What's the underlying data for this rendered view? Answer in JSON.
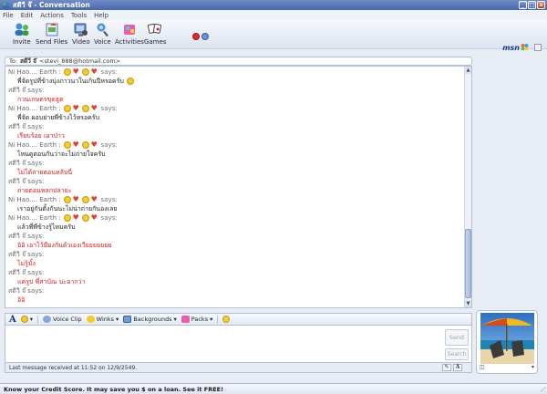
{
  "window": {
    "title": "สตีวี จ๊ - Conversation",
    "minimize": "_",
    "maximize": "□",
    "close": "x"
  },
  "menu": [
    "File",
    "Edit",
    "Actions",
    "Tools",
    "Help"
  ],
  "toolbar": {
    "items": [
      {
        "label": "Invite",
        "icon": "invite-icon"
      },
      {
        "label": "Send Files",
        "icon": "send-files-icon"
      },
      {
        "label": "Video",
        "icon": "video-icon"
      },
      {
        "label": "Voice",
        "icon": "voice-icon"
      },
      {
        "label": "Activities",
        "icon": "activities-icon"
      },
      {
        "label": "Games",
        "icon": "games-icon"
      }
    ],
    "brand": "msn"
  },
  "to_bar": {
    "prefix": "To:",
    "contact": "สตีวี จ๊",
    "email": "<stevi_888@hotmail.com>"
  },
  "chat": {
    "lines": [
      {
        "kind": "sender",
        "text": "Ni Hao.... Earth :",
        "emotes": [
          "smile",
          "heart",
          "smile",
          "heart"
        ],
        "suffix": "says:"
      },
      {
        "kind": "msg",
        "color": "black",
        "text": "พี่จัดรูปที่ข้างบุ่งภาวนาในเกินปีหรอครับ",
        "emotes": [
          "smile"
        ]
      },
      {
        "kind": "sender",
        "text": "สตีวี จ๊ says:"
      },
      {
        "kind": "msg",
        "color": "red",
        "text": "กวนเกษตรขุดธูต"
      },
      {
        "kind": "sender",
        "text": "Ni Hao.... Earth :",
        "emotes": [
          "smile",
          "heart",
          "smile",
          "heart"
        ],
        "suffix": "says:"
      },
      {
        "kind": "msg",
        "color": "black",
        "text": "พี่จัด ผอบย่ายพี่ข้างไว้หรอครับ"
      },
      {
        "kind": "sender",
        "text": "สตีวี จ๊ says:"
      },
      {
        "kind": "msg",
        "color": "red",
        "text": "เรียบร้อย เอาป่าว"
      },
      {
        "kind": "sender",
        "text": "Ni Hao.... Earth :",
        "emotes": [
          "smile",
          "heart",
          "smile",
          "heart"
        ],
        "suffix": "says:"
      },
      {
        "kind": "msg",
        "color": "black",
        "text": "ไหนดูตอนกันว่าจะไม่ถ่ายใจครับ"
      },
      {
        "kind": "sender",
        "text": "สตีวี จ๊ says:"
      },
      {
        "kind": "msg",
        "color": "red",
        "text": "ไม่ได้ถ่ายตอนหลับนี่"
      },
      {
        "kind": "sender",
        "text": "สตีวี จ๊ says:"
      },
      {
        "kind": "msg",
        "color": "red",
        "text": "ถ่ายตอนหลกปลาย่ะ"
      },
      {
        "kind": "sender",
        "text": "Ni Hao.... Earth :",
        "emotes": [
          "smile",
          "heart",
          "smile",
          "heart"
        ],
        "suffix": "says:"
      },
      {
        "kind": "msg",
        "color": "black",
        "text": "เราอยู่กันตั้งกันนะไม่น่าถ่ายกันองเลย"
      },
      {
        "kind": "sender",
        "text": "Ni Hao.... Earth :",
        "emotes": [
          "smile",
          "heart",
          "smile",
          "heart"
        ],
        "suffix": "says:"
      },
      {
        "kind": "msg",
        "color": "black",
        "text": "แล้วพี่พี่ข้างรู้ไหมครับ"
      },
      {
        "kind": "sender",
        "text": "สตีวี จ๊ says:"
      },
      {
        "kind": "msg",
        "color": "red",
        "text": "อิอิ เอาไว้มีองกันด้วเองเวียยยยยยย"
      },
      {
        "kind": "sender",
        "text": "สตีวี จ๊ says:"
      },
      {
        "kind": "msg",
        "color": "red",
        "text": "ไม่รู้มั้ง"
      },
      {
        "kind": "sender",
        "text": "สตีวี จ๊ says:"
      },
      {
        "kind": "msg",
        "color": "red",
        "text": "แค่รูป พี่สาบัณ นะอากว่า"
      },
      {
        "kind": "sender",
        "text": "สตีวี จ๊ says:"
      },
      {
        "kind": "msg",
        "color": "red",
        "text": "อิอิ"
      }
    ]
  },
  "format_bar": {
    "font_button": "A",
    "voice_clip": "Voice Clip",
    "winks": "Winks",
    "backgrounds": "Backgrounds",
    "packs": "Packs"
  },
  "input": {
    "send": "Send",
    "search": "Search"
  },
  "status": {
    "text": "Last message received at 11:52 on 12/9/2549."
  },
  "ad": {
    "text": "Know your Credit Score. It may save you $ on a loan. See it FREE!"
  }
}
